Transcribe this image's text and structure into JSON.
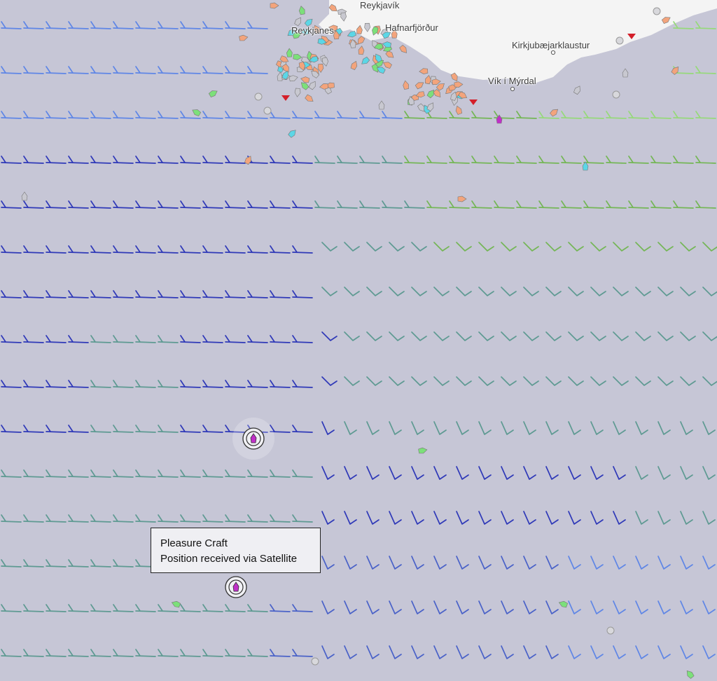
{
  "map": {
    "places": [
      {
        "name": "Reykjavík"
      },
      {
        "name": "Reykjanes"
      },
      {
        "name": "Hafnarfjörður"
      },
      {
        "name": "Kirkjubæjarklaustur"
      },
      {
        "name": "Vík í Mýrdal"
      }
    ],
    "tooltip": {
      "vessel_type": "Pleasure Craft",
      "position_source": "Position received via Satellite"
    },
    "colors": {
      "ocean": "#c6c6d6",
      "land": "#f4f4f4",
      "wind_light_green": "#96d97a",
      "wind_green": "#74b656",
      "wind_teal": "#5e9a92",
      "wind_blue": "#4a62c8",
      "wind_dark_blue": "#2f39b8",
      "wind_sky_blue": "#5f86e6",
      "vessel_pleasure": "#c030c8",
      "vessel_cargo": "#7ce07a",
      "vessel_fishing": "#f3a47c",
      "vessel_passenger": "#5cd6e6",
      "vessel_unknown": "#c8c8d0"
    },
    "icons": {
      "wind_barb": "wind-barb-icon",
      "vessel": "vessel-icon",
      "selected_vessel": "selected-vessel-icon",
      "town": "town-dot-icon"
    }
  }
}
